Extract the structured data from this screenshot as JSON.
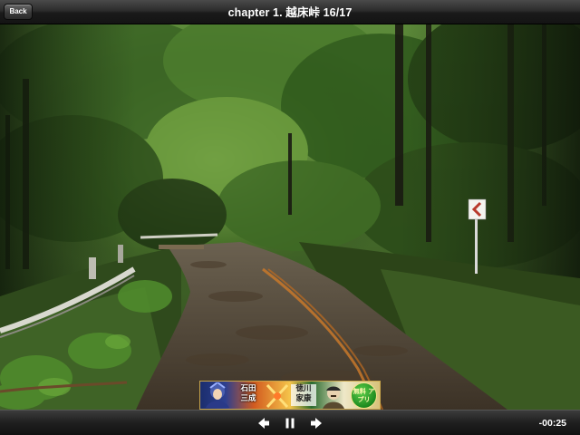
{
  "header": {
    "back_label": "Back",
    "title": "chapter 1. 越床峠 16/17"
  },
  "photo": {
    "description_icon": "forest-road-photo"
  },
  "ad_banner": {
    "left_text": "石田 三成",
    "right_text": "徳川 家康",
    "badge_text": "無料 アプリ"
  },
  "player": {
    "prev_icon": "arrow-left-icon",
    "pause_icon": "pause-icon",
    "next_icon": "arrow-right-icon",
    "time": "-00:25"
  },
  "colors": {
    "bar_dark": "#1a1a1a",
    "forest_green": "#3f6b2a",
    "road_brown": "#5a4a36",
    "road_line_orange": "#c8782a",
    "sign_red": "#b83a2c"
  }
}
